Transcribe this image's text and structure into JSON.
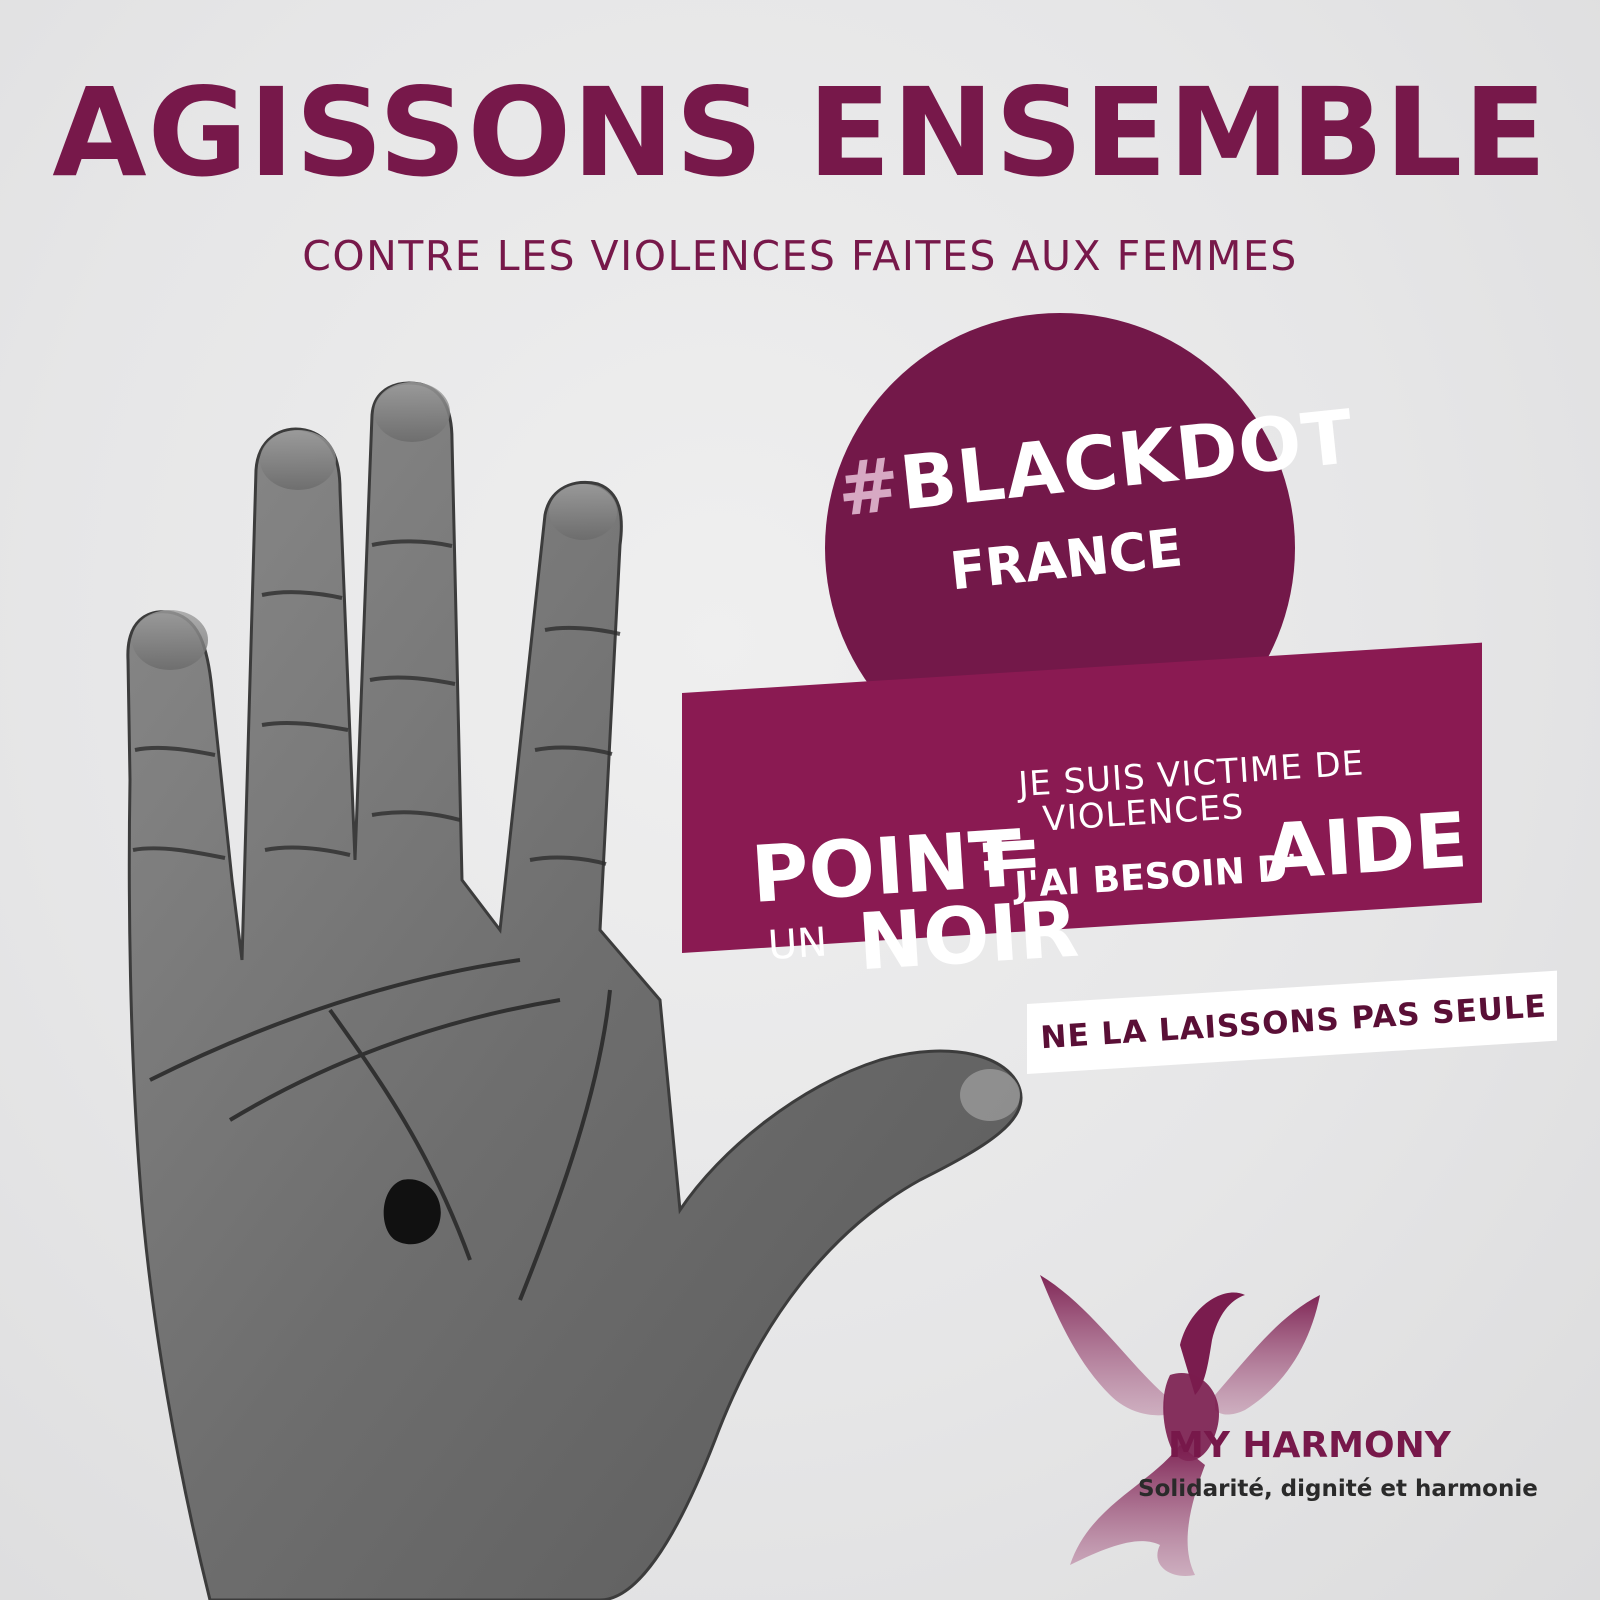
{
  "headline": "AGISSONS ENSEMBLE",
  "subheadline": "CONTRE LES VIOLENCES FAITES AUX FEMMES",
  "badge": {
    "hash": "#",
    "tag": "BLACKDOT",
    "country": "FRANCE"
  },
  "banner": {
    "point": "POINT",
    "un": "UN",
    "noir": "NOIR",
    "equals": "=",
    "line1": "JE SUIS VICTIME DE",
    "line2": "VIOLENCES",
    "line3": "J'AI BESOIN D'",
    "aide": "AIDE"
  },
  "strip": "NE LA LAISSONS PAS SEULE",
  "logo": {
    "name": "MY HARMONY",
    "tagline": "Solidarité, dignité et harmonie"
  },
  "colors": {
    "brand": "#77184a",
    "badge": "#731849",
    "banner": "#8a1a52",
    "background": "#e9e9ea"
  }
}
